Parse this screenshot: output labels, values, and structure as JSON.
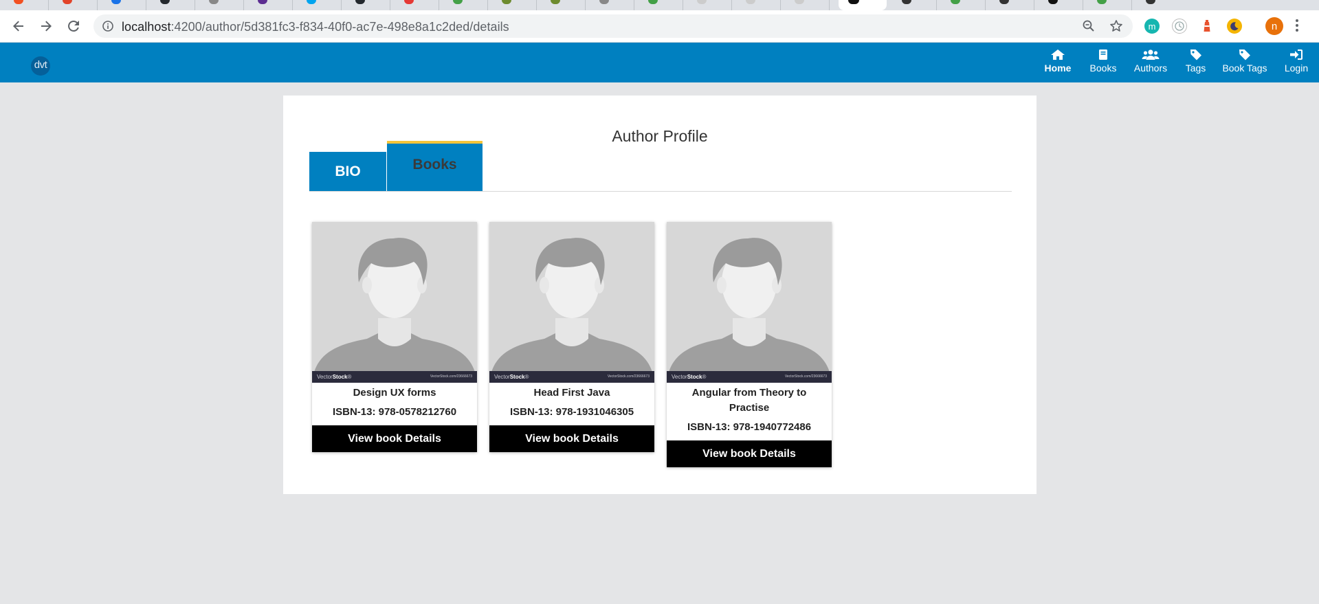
{
  "browser": {
    "url_host": "localhost",
    "url_path": ":4200/author/5d381fc3-f834-40f0-ac7e-498e8a1c2ded/details",
    "extensions": [
      {
        "name": "m-extension-icon",
        "letter": "m",
        "color": "#16b6b0"
      },
      {
        "name": "clock-extension-icon",
        "letter": "",
        "color": "#ffffff"
      },
      {
        "name": "lighthouse-extension-icon",
        "letter": "",
        "color": "#e8532f"
      },
      {
        "name": "moon-extension-icon",
        "letter": "",
        "color": "#f4b400"
      }
    ],
    "profile_letter": "n"
  },
  "app": {
    "logo": "dvt",
    "nav": [
      {
        "label": "Home",
        "icon": "home-icon",
        "active": true
      },
      {
        "label": "Books",
        "icon": "book-icon",
        "active": false
      },
      {
        "label": "Authors",
        "icon": "users-icon",
        "active": false
      },
      {
        "label": "Tags",
        "icon": "tag-icon",
        "active": false
      },
      {
        "label": "Book Tags",
        "icon": "tag-icon",
        "active": false
      },
      {
        "label": "Login",
        "icon": "sign-in-icon",
        "active": false
      }
    ]
  },
  "profile": {
    "title": "Author Profile",
    "tabs": [
      "BIO",
      "Books"
    ],
    "active_tab": "Books"
  },
  "cover_watermark": {
    "brand_light": "Vector",
    "brand_bold": "Stock",
    "reg": "®",
    "small": "VectorStock.com/23666673"
  },
  "books": [
    {
      "title": "Design UX forms",
      "isbn": "ISBN-13: 978-0578212760",
      "button": "View book Details"
    },
    {
      "title": "Head First Java",
      "isbn": "ISBN-13: 978-1931046305",
      "button": "View book Details"
    },
    {
      "title": "Angular from Theory to Practise",
      "isbn": "ISBN-13: 978-1940772486",
      "button": "View book Details"
    }
  ]
}
